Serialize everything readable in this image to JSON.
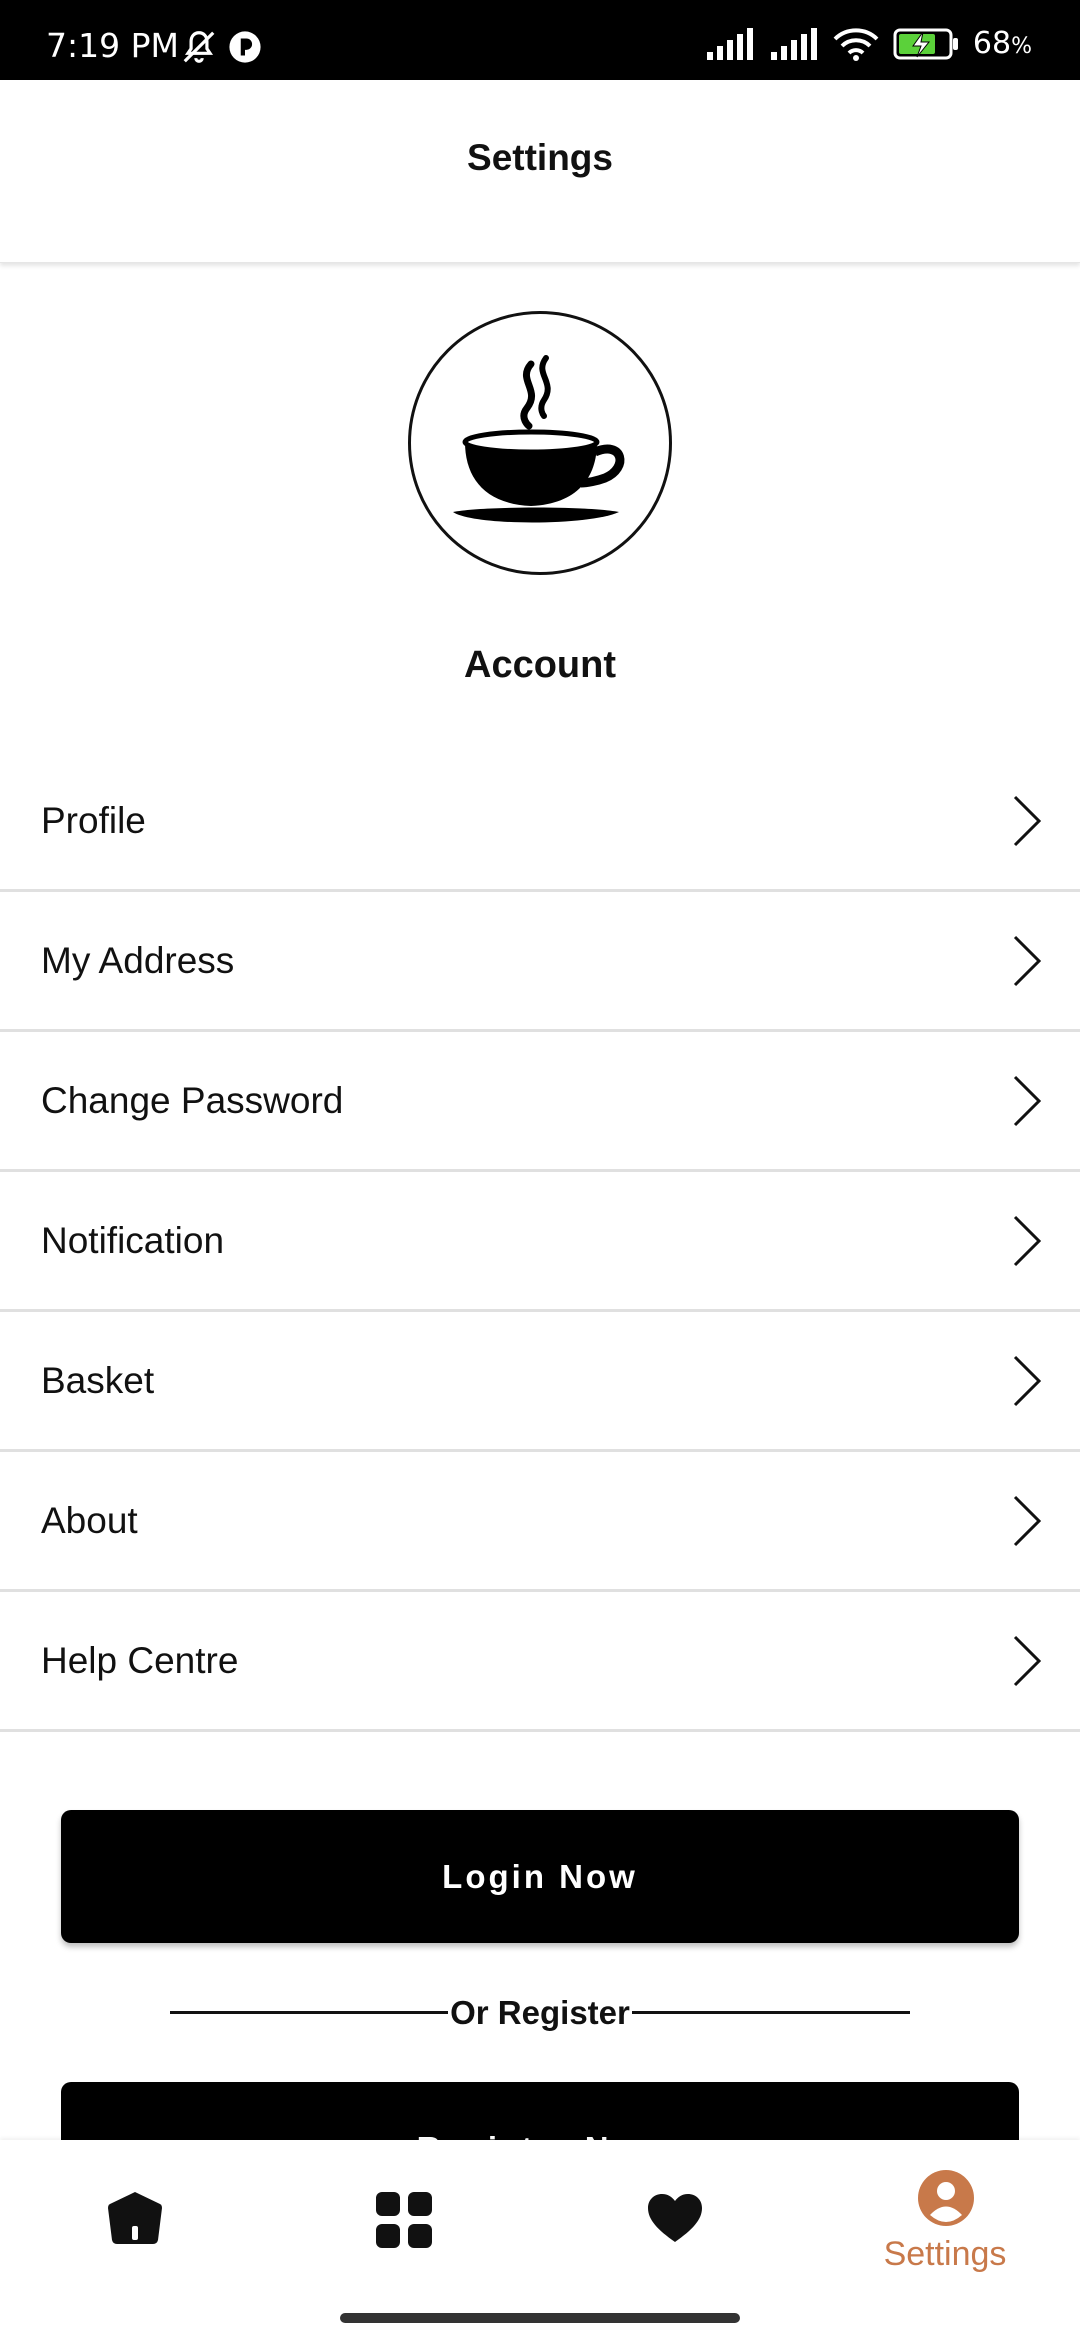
{
  "status_bar": {
    "time": "7:19 PM",
    "battery": "68",
    "battery_unit": "%",
    "icons": [
      "bell-off-icon",
      "app-notification-icon",
      "signal-icon",
      "signal-icon",
      "wifi-icon",
      "battery-charging-icon"
    ]
  },
  "header": {
    "title": "Settings"
  },
  "avatar": {
    "icon": "coffee-cup-icon"
  },
  "account": {
    "title": "Account"
  },
  "menu": {
    "items": [
      {
        "label": "Profile"
      },
      {
        "label": "My Address"
      },
      {
        "label": "Change Password"
      },
      {
        "label": "Notification"
      },
      {
        "label": "Basket"
      },
      {
        "label": "About"
      },
      {
        "label": "Help Centre"
      }
    ]
  },
  "actions": {
    "login_label": "Login Now",
    "or_label": "Or Register",
    "register_label": "Register Now"
  },
  "bottom_nav": {
    "items": [
      {
        "icon": "home-icon",
        "label": ""
      },
      {
        "icon": "grid-icon",
        "label": ""
      },
      {
        "icon": "heart-icon",
        "label": ""
      },
      {
        "icon": "profile-icon",
        "label": "Settings",
        "active": true
      }
    ],
    "active_color": "#c8794a",
    "inactive_color": "#111111"
  }
}
